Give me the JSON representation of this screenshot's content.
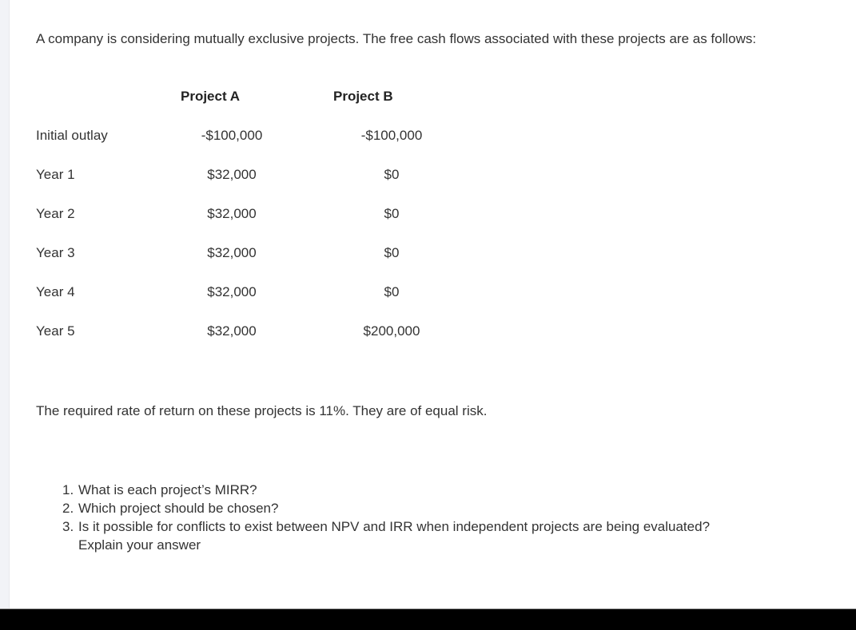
{
  "intro": "A company is considering mutually exclusive projects.  The free cash flows associated with these projects are as follows:",
  "table": {
    "columns": [
      "Project A",
      "Project B"
    ],
    "rows": [
      {
        "label": "Initial outlay",
        "a": "-$100,000",
        "b": "-$100,000"
      },
      {
        "label": "Year 1",
        "a": "$32,000",
        "b": "$0"
      },
      {
        "label": "Year 2",
        "a": "$32,000",
        "b": "$0"
      },
      {
        "label": "Year 3",
        "a": "$32,000",
        "b": "$0"
      },
      {
        "label": "Year 4",
        "a": "$32,000",
        "b": "$0"
      },
      {
        "label": "Year 5",
        "a": "$32,000",
        "b": "$200,000"
      }
    ]
  },
  "rate_statement": "The required rate of return on these projects is 11%.  They are of equal risk.",
  "questions": [
    {
      "num": "1.",
      "text": "What is each project’s MIRR?"
    },
    {
      "num": "2.",
      "text": "Which project should be chosen?"
    },
    {
      "num": "3.",
      "text": "Is it possible for conflicts to exist between NPV and IRR when independent projects are being evaluated?",
      "continuation": "Explain your answer"
    }
  ]
}
